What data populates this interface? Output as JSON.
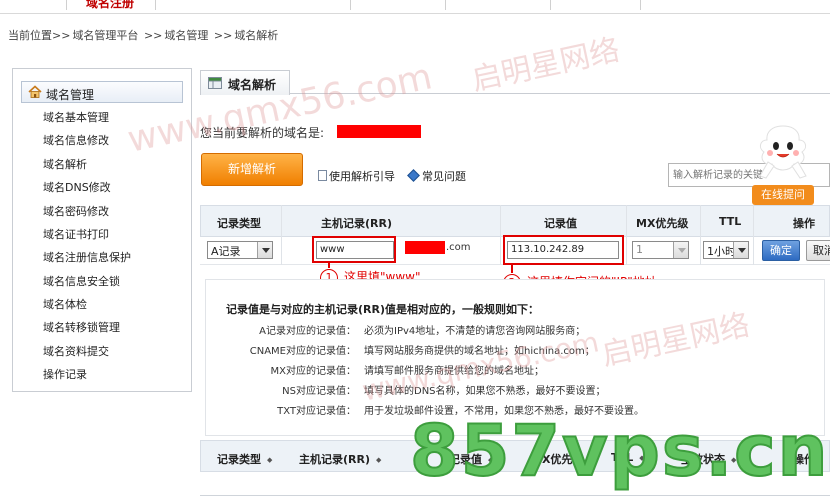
{
  "topnav": {
    "active_label": "域名注册"
  },
  "breadcrumb": {
    "prefix": "当前位置>>",
    "item1": "域名管理平台",
    "sep1": ">>",
    "item2": "域名管理",
    "sep2": ">>",
    "item3": "域名解析"
  },
  "sidebar": {
    "header": "域名管理",
    "items": [
      "域名基本管理",
      "域名信息修改",
      "域名解析",
      "域名DNS修改",
      "域名密码修改",
      "域名证书打印",
      "域名注册信息保护",
      "域名信息安全锁",
      "域名体检",
      "域名转移锁管理",
      "域名资料提交",
      "操作记录"
    ]
  },
  "tab": {
    "label": "域名解析"
  },
  "domain_prompt": "您当前要解析的域名是:",
  "actions": {
    "add_label": "新增解析",
    "guide_label": "使用解析引导",
    "faq_label": "常见问题",
    "search_placeholder": "输入解析记录的关键",
    "help_label": "在线提问"
  },
  "grid": {
    "headers": [
      "记录类型",
      "主机记录(RR)",
      "记录值",
      "MX优先级",
      "TTL",
      "操作"
    ],
    "row": {
      "type": "A记录",
      "host": "www",
      "suffix": ".com",
      "value": "113.10.242.89",
      "mx": "1",
      "ttl": "1小时",
      "ok": "确定",
      "cancel": "取消"
    }
  },
  "callouts": [
    {
      "num": "1",
      "text": "这里填\"www\""
    },
    {
      "num": "2",
      "text": "这里填你空间的\"IP\"地址"
    }
  ],
  "rules": {
    "title": "记录值是与对应的主机记录(RR)值是相对应的，一般规则如下：",
    "items": [
      {
        "k": "A记录对应的记录值：",
        "v": "必须为IPv4地址，不清楚的请您咨询网站服务商；"
      },
      {
        "k": "CNAME对应的记录值：",
        "v": "填写网站服务商提供的域名地址；如hichina.com；"
      },
      {
        "k": "MX对应的记录值：",
        "v": "请填写邮件服务商提供给您的域名地址；"
      },
      {
        "k": "NS对应记录值：",
        "v": "填写具体的DNS名称，如果您不熟悉，最好不要设置；"
      },
      {
        "k": "TXT对应记录值：",
        "v": "用于发垃圾邮件设置，不常用，如果您不熟悉，最好不要设置。"
      }
    ]
  },
  "grid2": {
    "headers": [
      "记录类型",
      "主机记录(RR)",
      "记录值",
      "MX优先级",
      "TTL",
      "生效状态",
      "操作"
    ]
  },
  "watermarks": {
    "url": "www.qmx56.com",
    "brand": "启明星网络",
    "big": "857vps.cn"
  },
  "colors": {
    "redact": "#ff0000",
    "accent_orange": "#f07f00",
    "callout_red": "#e00000",
    "watermark_green": "#5fc25f"
  }
}
